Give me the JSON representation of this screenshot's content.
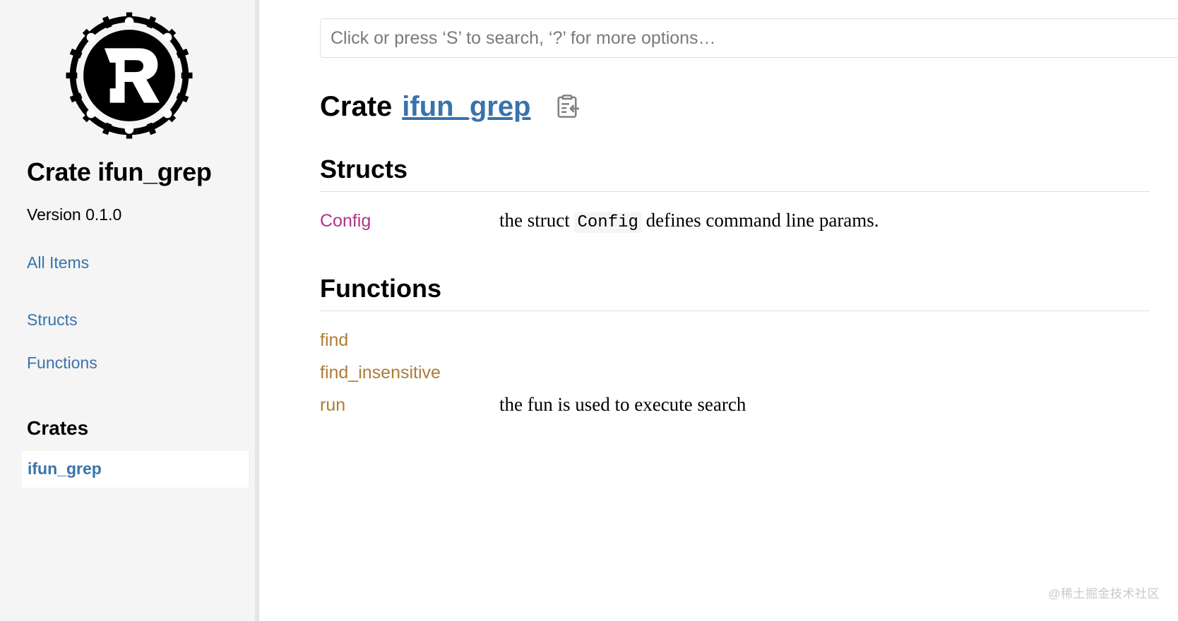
{
  "sidebar": {
    "logo_icon": "rust-logo-icon",
    "title": "Crate ifun_grep",
    "version": "Version 0.1.0",
    "all_items_label": "All Items",
    "nav_links": [
      {
        "label": "Structs"
      },
      {
        "label": "Functions"
      }
    ],
    "crates_heading": "Crates",
    "crates": [
      {
        "label": "ifun_grep",
        "selected": true
      }
    ]
  },
  "search": {
    "value": "",
    "placeholder": "Click or press ‘S’ to search, ‘?’ for more options…"
  },
  "main": {
    "crate_keyword": "Crate",
    "crate_name": "ifun_grep",
    "copy_path_icon": "copy-item-path-icon",
    "sections": [
      {
        "heading": "Structs",
        "items": [
          {
            "name": "Config",
            "kind": "struct",
            "desc_before": "the struct ",
            "desc_code": "Config",
            "desc_after": " defines command line params."
          }
        ]
      },
      {
        "heading": "Functions",
        "items": [
          {
            "name": "find",
            "kind": "fn",
            "desc_before": "",
            "desc_code": "",
            "desc_after": ""
          },
          {
            "name": "find_insensitive",
            "kind": "fn",
            "desc_before": "",
            "desc_code": "",
            "desc_after": ""
          },
          {
            "name": "run",
            "kind": "fn",
            "desc_before": "the fun is used to execute search",
            "desc_code": "",
            "desc_after": ""
          }
        ]
      }
    ]
  },
  "watermark": "@稀土掘金技术社区",
  "colors": {
    "link_blue": "#3873ad",
    "struct_magenta": "#ad378a",
    "fn_gold": "#ad7c37",
    "sidebar_bg": "#f5f5f5",
    "code_bg": "#f5f5f5"
  }
}
